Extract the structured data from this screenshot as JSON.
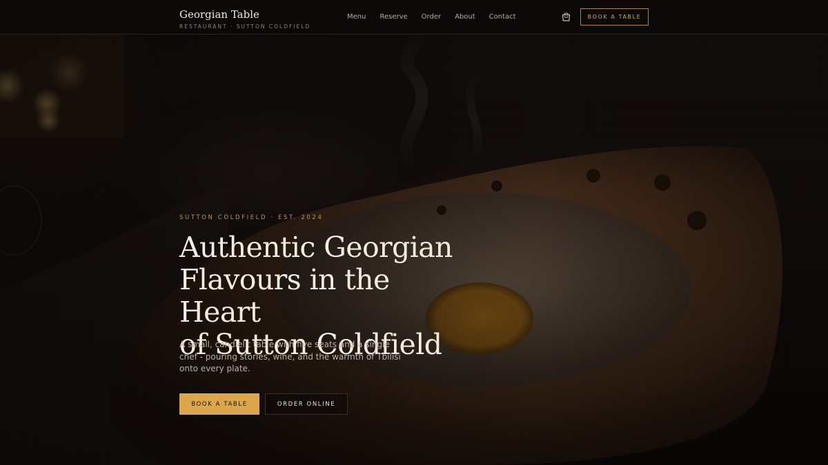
{
  "header": {
    "brand_name": "Georgian Table",
    "brand_tagline": "RESTAURANT · SUTTON COLDFIELD",
    "nav": [
      "Menu",
      "Reserve",
      "Order",
      "About",
      "Contact"
    ],
    "cart_icon": "shopping-bag-icon",
    "book_button": "BOOK A TABLE"
  },
  "hero": {
    "eyebrow": "SUTTON COLDFIELD · EST. 2024",
    "headline_lines": [
      "Authentic Georgian",
      "Flavours in the Heart",
      "of Sutton Coldfield"
    ],
    "lede": "A small, candlelit table with five seats and a single chef - pouring stories, wine, and the warmth of Tbilisi onto every plate.",
    "primary_button": "BOOK A TABLE",
    "secondary_button": "ORDER ONLINE"
  },
  "colors": {
    "accent": "#dca64a",
    "accent_outline": "#a98443",
    "background": "#0b0807",
    "text": "#f3ecdf"
  }
}
